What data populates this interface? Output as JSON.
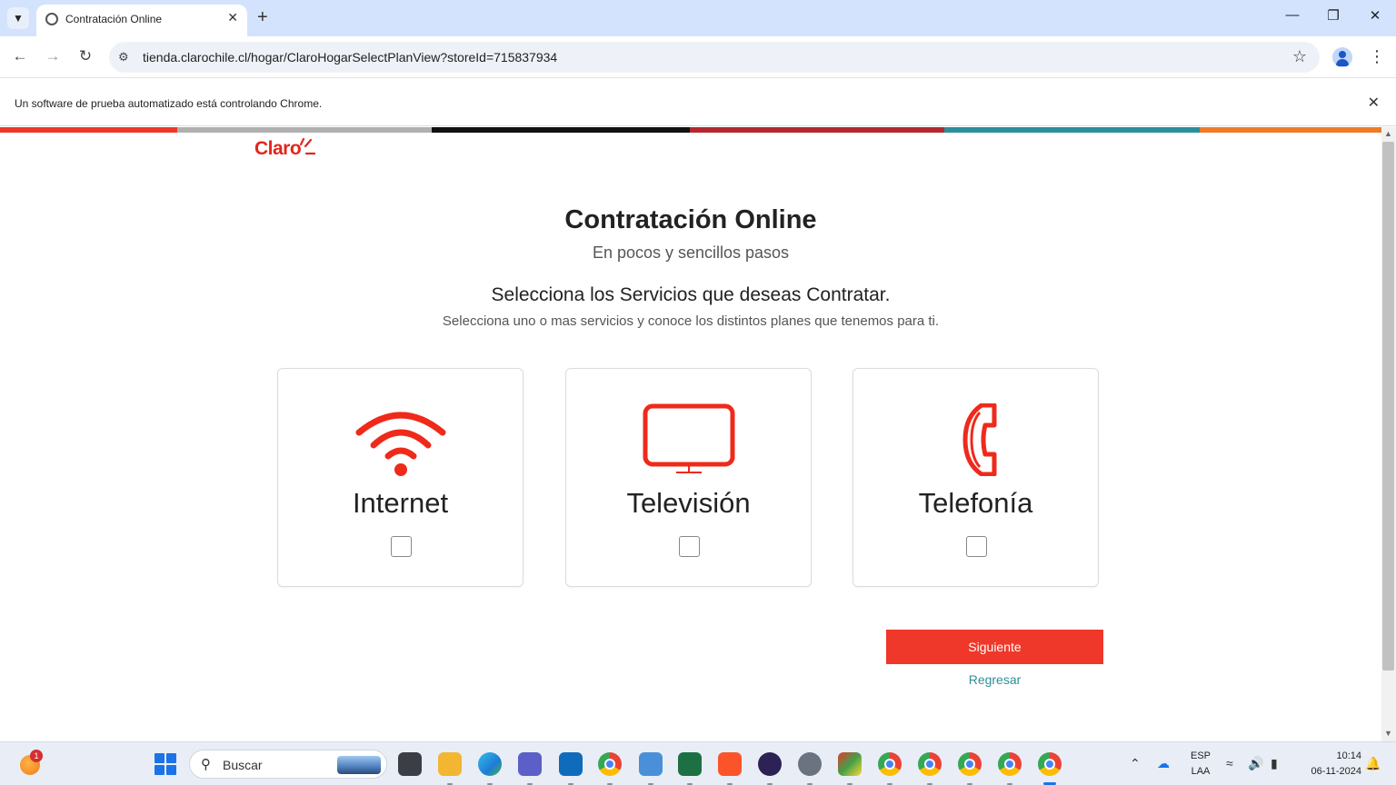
{
  "browser": {
    "tab_title": "Contratación Online",
    "url": "tienda.clarochile.cl/hogar/ClaroHogarSelectPlanView?storeId=715837934",
    "infobar_text": "Un software de prueba automatizado está controlando Chrome."
  },
  "page": {
    "logo_text": "Claro",
    "title": "Contratación Online",
    "subtitle": "En pocos y sencillos pasos",
    "section_title": "Selecciona los Servicios que deseas Contratar.",
    "section_subtitle": "Selecciona uno o mas servicios y conoce los distintos planes que tenemos para ti.",
    "services": [
      {
        "label": "Internet",
        "icon": "wifi-icon",
        "checked": false
      },
      {
        "label": "Televisión",
        "icon": "tv-icon",
        "checked": false
      },
      {
        "label": "Telefonía",
        "icon": "phone-icon",
        "checked": false
      }
    ],
    "next_button": "Siguiente",
    "back_link": "Regresar"
  },
  "colors": {
    "brand_red": "#ef3829",
    "link_teal": "#2f8f93",
    "strip": [
      "#ef3829",
      "#b0b0b0",
      "#111111",
      "#b3282f",
      "#2a8f9a",
      "#ee7b2a"
    ]
  },
  "taskbar": {
    "search_placeholder": "Buscar",
    "weather_badge": "1",
    "lang_top": "ESP",
    "lang_bottom": "LAA",
    "time": "10:14",
    "date": "06-11-2024"
  }
}
